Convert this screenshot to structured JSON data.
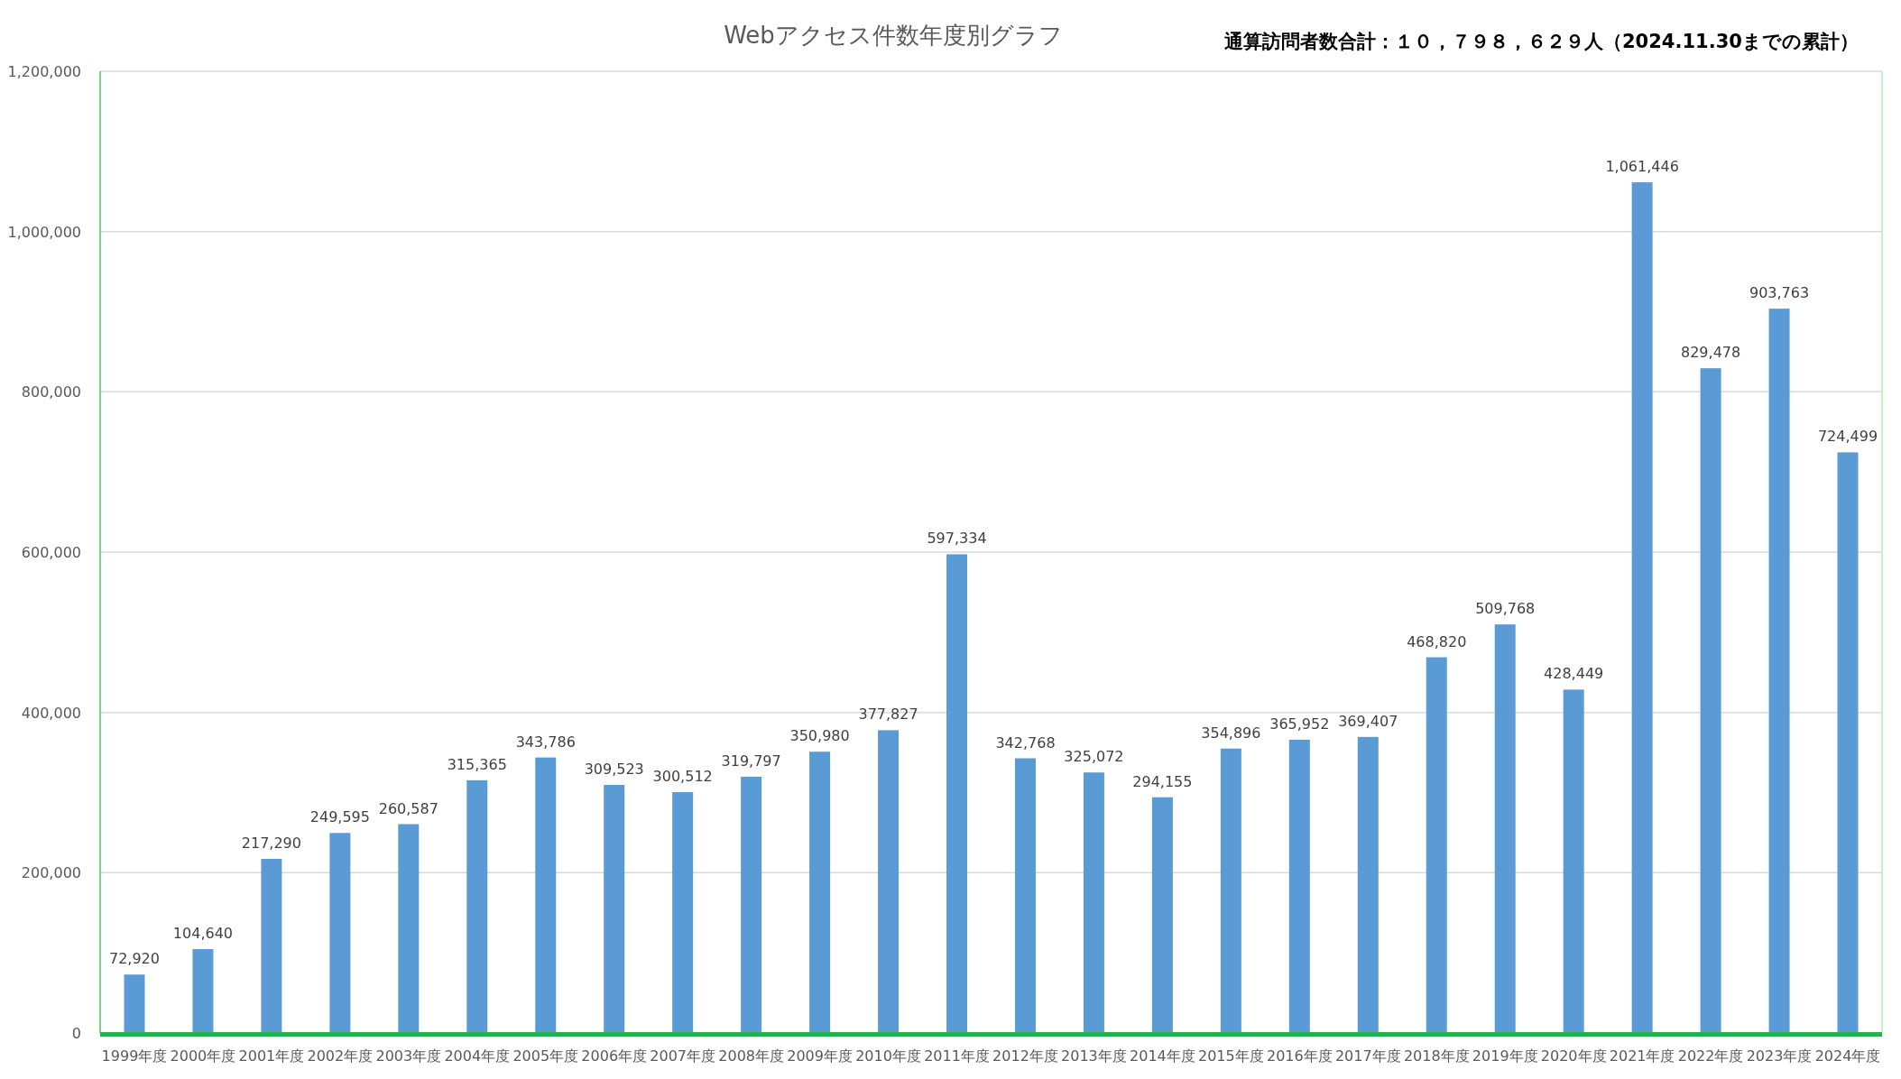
{
  "chart": {
    "note": "通算訪問者数合計：１０，７９８，６２９人（2024.11.30までの累計）",
    "chart_data": {
      "type": "bar",
      "title": "Webアクセス件数年度別グラフ",
      "categories": [
        "1999年度",
        "2000年度",
        "2001年度",
        "2002年度",
        "2003年度",
        "2004年度",
        "2005年度",
        "2006年度",
        "2007年度",
        "2008年度",
        "2009年度",
        "2010年度",
        "2011年度",
        "2012年度",
        "2013年度",
        "2014年度",
        "2015年度",
        "2016年度",
        "2017年度",
        "2018年度",
        "2019年度",
        "2020年度",
        "2021年度",
        "2022年度",
        "2023年度",
        "2024年度"
      ],
      "series": [
        {
          "color": "#5b9bd5",
          "values": [
            72920,
            104640,
            217290,
            249595,
            260587,
            315365,
            343786,
            309523,
            300512,
            319797,
            350980,
            377827,
            597334,
            342768,
            325072,
            294155,
            354896,
            365952,
            369407,
            468820,
            509768,
            428449,
            1061446,
            829478,
            903763,
            724499
          ]
        }
      ],
      "value_labels": [
        [
          "72,920",
          "104,640",
          "217,290",
          "249,595",
          "260,587",
          "315,365",
          "343,786",
          "309,523",
          "300,512",
          "319,797",
          "350,980",
          "377,827",
          "597,334",
          "342,768",
          "325,072",
          "294,155",
          "354,896",
          "365,952",
          "369,407",
          "468,820",
          "509,768",
          "428,449",
          "1,061,446",
          "829,478",
          "903,763",
          "724,499"
        ]
      ],
      "ylim": [
        0,
        1200000
      ],
      "yticks": [
        {
          "value": 0,
          "label": "0"
        },
        {
          "value": 200000,
          "label": "200,000"
        },
        {
          "value": 400000,
          "label": "400,000"
        },
        {
          "value": 600000,
          "label": "600,000"
        },
        {
          "value": 800000,
          "label": "800,000"
        },
        {
          "value": 1000000,
          "label": "1,000,000"
        },
        {
          "value": 1200000,
          "label": "1,200,000"
        }
      ],
      "grid": true
    }
  }
}
